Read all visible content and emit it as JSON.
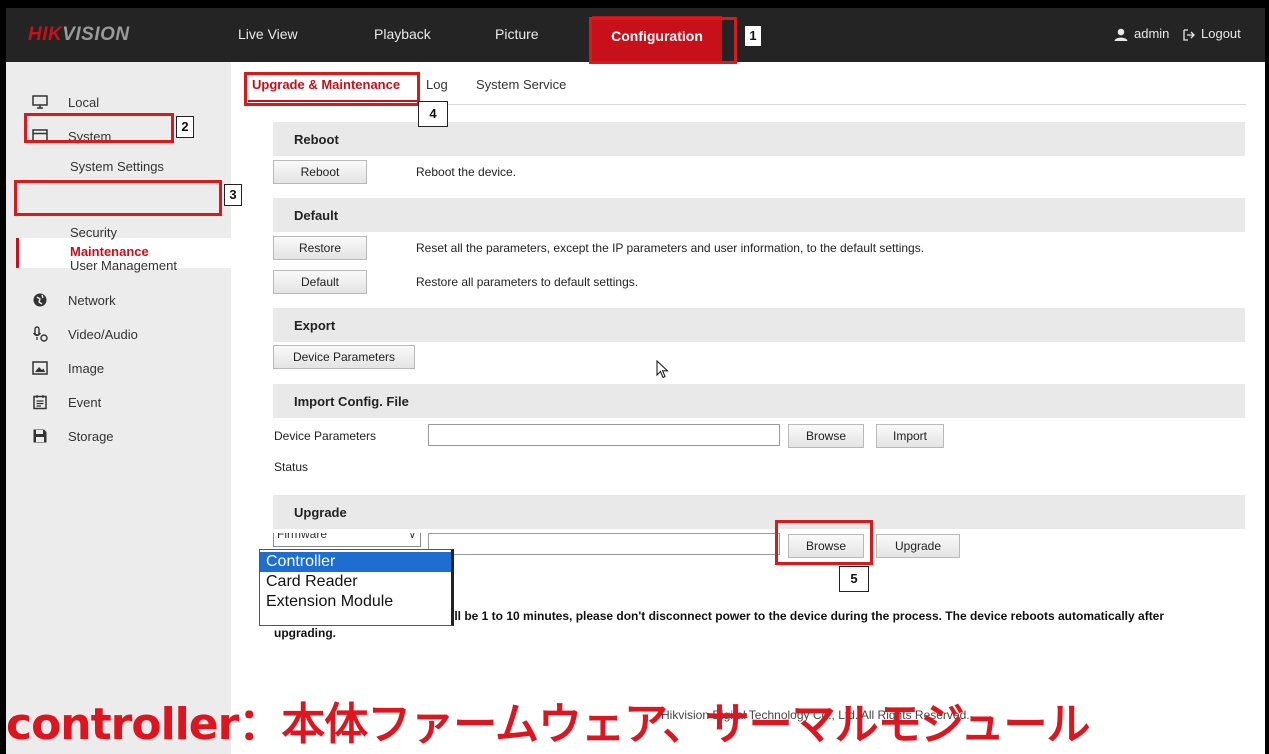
{
  "brand": {
    "hik": "HIK",
    "vision": "VISION"
  },
  "nav": {
    "live_view": "Live View",
    "playback": "Playback",
    "picture": "Picture",
    "configuration": "Configuration",
    "user": "admin",
    "logout": "Logout"
  },
  "sidebar": {
    "local": "Local",
    "system": "System",
    "system_settings": "System Settings",
    "maintenance": "Maintenance",
    "security": "Security",
    "user_management": "User Management",
    "network": "Network",
    "video_audio": "Video/Audio",
    "image": "Image",
    "event": "Event",
    "storage": "Storage"
  },
  "tabs": {
    "upgrade": "Upgrade & Maintenance",
    "log": "Log",
    "system_service": "System Service"
  },
  "reboot": {
    "title": "Reboot",
    "button": "Reboot",
    "desc": "Reboot the device."
  },
  "default": {
    "title": "Default",
    "restore_button": "Restore",
    "restore_desc": "Reset all the parameters, except the IP parameters and user information, to the default settings.",
    "default_button": "Default",
    "default_desc": "Restore all parameters to default settings."
  },
  "export": {
    "title": "Export",
    "button": "Device Parameters"
  },
  "import": {
    "title": "Import Config. File",
    "label": "Device Parameters",
    "browse": "Browse",
    "import_button": "Import",
    "status_label": "Status"
  },
  "upgrade": {
    "title": "Upgrade",
    "select_value": "Firmware",
    "options": [
      "Controller",
      "Card Reader",
      "Extension Module"
    ],
    "browse": "Browse",
    "upgrade_button": "Upgrade",
    "notice_line1": "ill be 1 to 10 minutes, please don't disconnect power to the device during the process. The device reboots automatically after",
    "notice_line2": "upgrading."
  },
  "footer": {
    "copyright": "Hikvision Digital Technology Co., Ltd. All Rights Reserved."
  },
  "annotations": [
    "1",
    "2",
    "3",
    "4",
    "5"
  ],
  "caption": "controller：本体ファームウェア、サーマルモジュール",
  "colors": {
    "accent": "#c8101a",
    "annotation": "#d81a1a",
    "caption": "#e0141e",
    "selected_option": "#1e6ed2"
  }
}
